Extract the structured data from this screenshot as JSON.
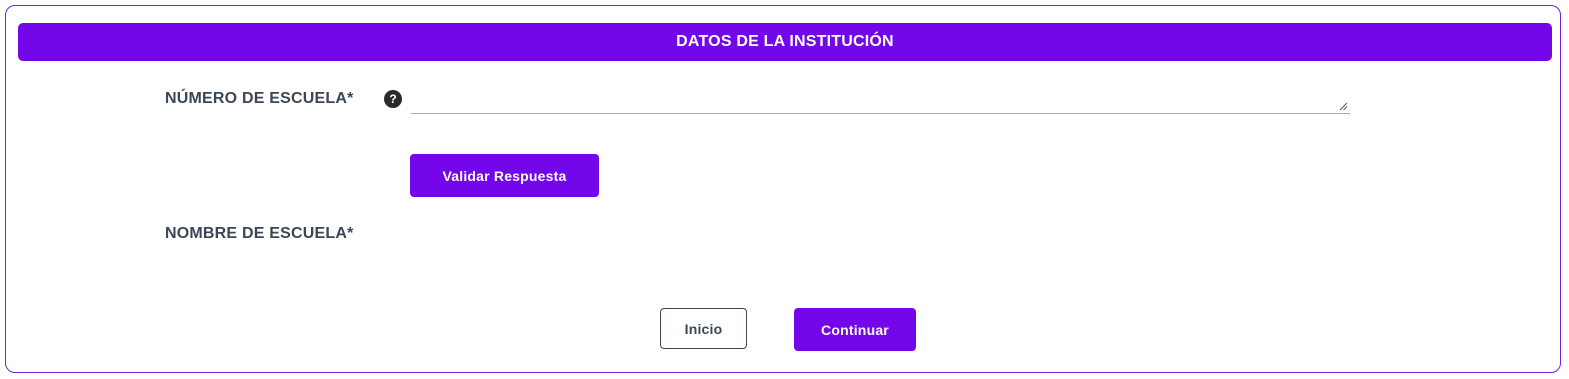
{
  "section": {
    "title": "DATOS DE LA INSTITUCIÓN"
  },
  "fields": {
    "numero_escuela": {
      "label": "NÚMERO DE ESCUELA*",
      "help_icon": "?",
      "value": ""
    },
    "nombre_escuela": {
      "label": "NOMBRE DE ESCUELA*"
    }
  },
  "buttons": {
    "validar": "Validar Respuesta",
    "inicio": "Inicio",
    "continuar": "Continuar"
  },
  "colors": {
    "accent": "#7406ea",
    "label_text": "#3b4757",
    "border": "#7a1fd6"
  },
  "icons": {
    "help": "question-circle-icon",
    "resize": "resize-handle-icon"
  }
}
